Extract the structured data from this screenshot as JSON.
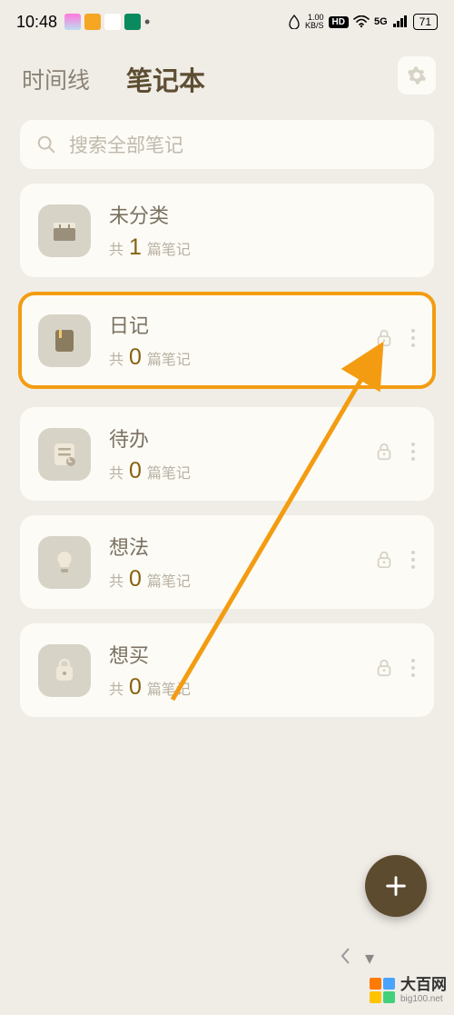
{
  "status": {
    "time": "10:48",
    "kbs_top": "1.00",
    "kbs_bottom": "KB/S",
    "hd": "HD",
    "net": "5G",
    "battery": "71"
  },
  "tabs": {
    "timeline": "时间线",
    "notebook": "笔记本"
  },
  "search": {
    "placeholder": "搜索全部笔记"
  },
  "labels": {
    "prefix": "共",
    "suffix": "篇笔记"
  },
  "notebooks": [
    {
      "title": "未分类",
      "count": "1",
      "lock": false,
      "more": false,
      "highlight": false,
      "icon": "box"
    },
    {
      "title": "日记",
      "count": "0",
      "lock": true,
      "more": true,
      "highlight": true,
      "icon": "book"
    },
    {
      "title": "待办",
      "count": "0",
      "lock": true,
      "more": true,
      "highlight": false,
      "icon": "checklist"
    },
    {
      "title": "想法",
      "count": "0",
      "lock": true,
      "more": true,
      "highlight": false,
      "icon": "bulb"
    },
    {
      "title": "想买",
      "count": "0",
      "lock": true,
      "more": true,
      "highlight": false,
      "icon": "bag"
    }
  ],
  "watermark": {
    "name": "大百网",
    "url": "big100.net"
  },
  "colors": {
    "accent": "#f39c12",
    "fab": "#5d4b2f"
  }
}
